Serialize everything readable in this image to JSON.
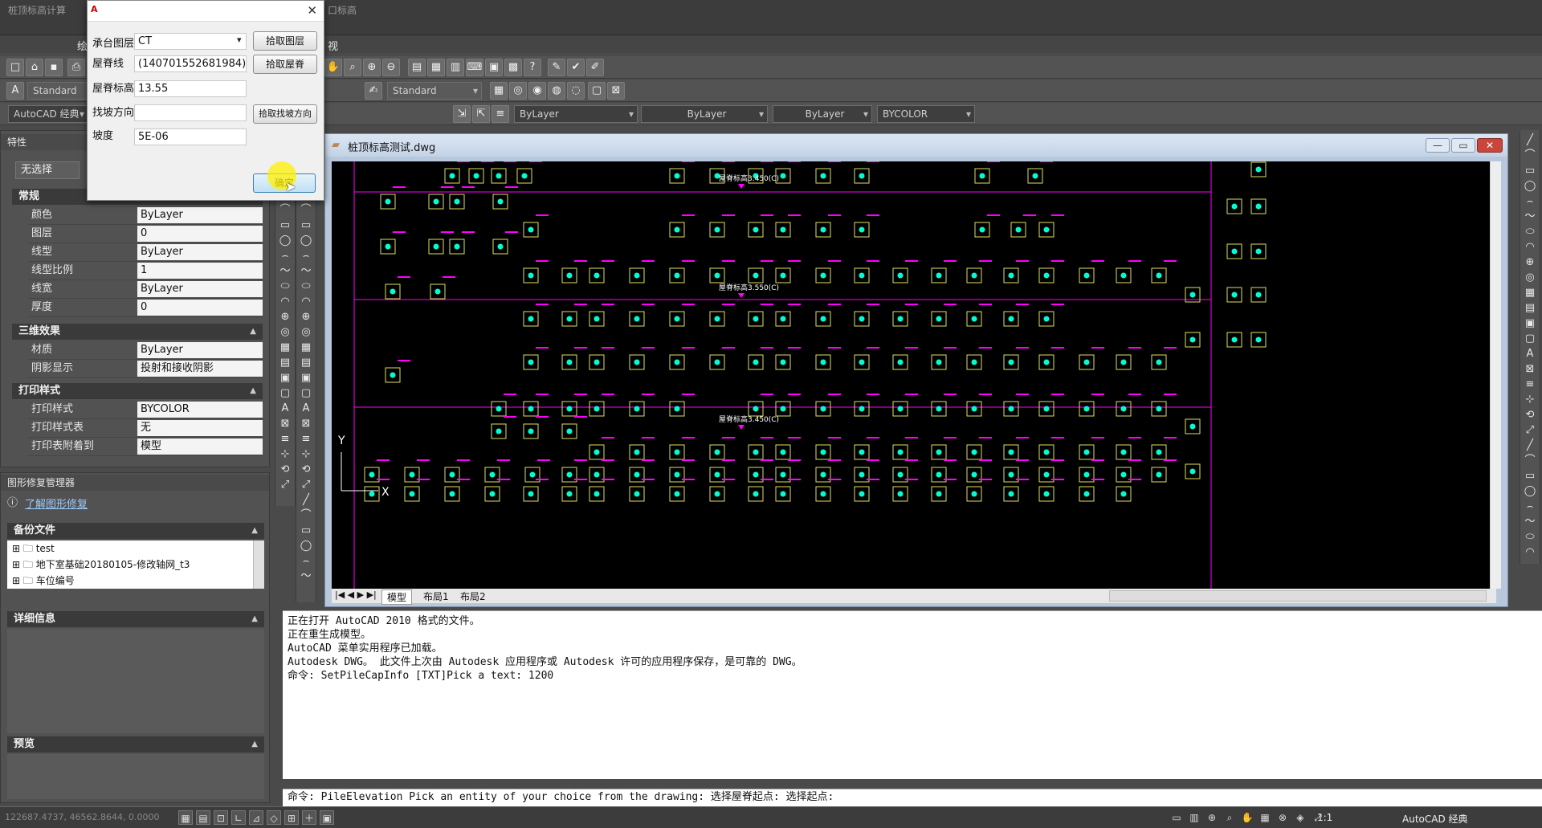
{
  "window": {
    "app_title_left": "桩顶标高计算",
    "app_title_tail": "口标高",
    "menu_partial": [
      "绘",
      "视"
    ]
  },
  "toolbar": {
    "text_style": "Standard",
    "dim_style": "Standard",
    "workspace": "AutoCAD 经典",
    "color": "ByLayer",
    "linetype": "ByLayer",
    "lineweight": "ByLayer",
    "plotstyle": "BYCOLOR"
  },
  "properties": {
    "title": "特性",
    "selection": "无选择",
    "sections": {
      "general": "常规",
      "three_d": "三维效果",
      "plot": "打印样式"
    },
    "general_rows": [
      {
        "label": "颜色",
        "value": "ByLayer"
      },
      {
        "label": "图层",
        "value": "0"
      },
      {
        "label": "线型",
        "value": "ByLayer"
      },
      {
        "label": "线型比例",
        "value": "1"
      },
      {
        "label": "线宽",
        "value": "ByLayer"
      },
      {
        "label": "厚度",
        "value": "0"
      }
    ],
    "three_d_rows": [
      {
        "label": "材质",
        "value": "ByLayer"
      },
      {
        "label": "阴影显示",
        "value": "投射和接收阴影"
      }
    ],
    "plot_rows": [
      {
        "label": "打印样式",
        "value": "BYCOLOR"
      },
      {
        "label": "打印样式表",
        "value": "无"
      },
      {
        "label": "打印表附着到",
        "value": "模型"
      }
    ]
  },
  "recovery": {
    "title": "图形修复管理器",
    "learn_link": "了解图形修复",
    "backup_header": "备份文件",
    "files": [
      "test",
      "地下室基础20180105-修改轴网_t3",
      "车位编号"
    ],
    "details_header": "详细信息",
    "preview_header": "预览"
  },
  "dialog": {
    "layer_label": "承台图层",
    "layer_value": "CT",
    "pick_layer_btn": "拾取图层",
    "beam_label": "屋脊线",
    "beam_value": "(140701552681984)",
    "pick_beam_btn": "拾取屋脊",
    "elev_label": "屋脊标高",
    "elev_value": "13.55",
    "dir_label": "找坡方向",
    "dir_value": "",
    "pick_dir_btn": "拾取找坡方向",
    "slope_label": "坡度",
    "slope_value": "5E-06",
    "ok_btn": "确定"
  },
  "drawing": {
    "title": "桩顶标高测试.dwg",
    "tabs": [
      "模型",
      "布局1",
      "布局2"
    ],
    "labels": [
      "屋脊标高3.450(C)",
      "屋脊标高3.550(C)",
      "屋脊标高3.450(C)"
    ],
    "ucs": {
      "y": "Y",
      "x": "X"
    }
  },
  "command": {
    "history": [
      "正在打开 AutoCAD 2010 格式的文件。",
      "正在重生成模型。",
      "AutoCAD 菜单实用程序已加载。",
      "Autodesk DWG。  此文件上次由 Autodesk 应用程序或 Autodesk 许可的应用程序保存，是可靠的 DWG。",
      "命令: SetPileCapInfo [TXT]Pick a text: 1200"
    ],
    "current": "命令: PileElevation Pick an entity of your choice from the drawing: 选择屋脊起点: 选择起点:"
  },
  "status": {
    "coords": "122687.4737, 46562.8644, 0.0000",
    "scale": "1:1",
    "workspace": "AutoCAD 经典"
  },
  "colors": {
    "magenta": "#ff00ff",
    "cyan": "#00ffcc",
    "yellow_box": "#e0e060"
  }
}
